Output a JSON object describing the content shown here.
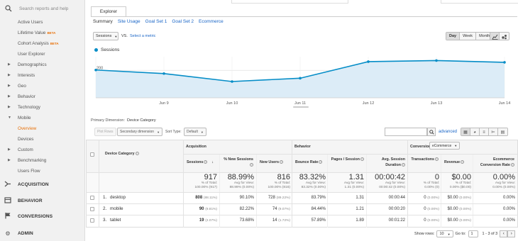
{
  "sidebar": {
    "search_placeholder": "Search reports and help",
    "items": [
      {
        "label": "Active Users",
        "beta": ""
      },
      {
        "label": "Lifetime Value",
        "beta": "BETA"
      },
      {
        "label": "Cohort Analysis",
        "beta": "BETA"
      },
      {
        "label": "User Explorer",
        "beta": ""
      },
      {
        "label": "Demographics",
        "beta": ""
      },
      {
        "label": "Interests",
        "beta": ""
      },
      {
        "label": "Geo",
        "beta": ""
      },
      {
        "label": "Behavior",
        "beta": ""
      },
      {
        "label": "Technology",
        "beta": ""
      },
      {
        "label": "Mobile",
        "beta": ""
      },
      {
        "label": "Overview",
        "beta": ""
      },
      {
        "label": "Devices",
        "beta": ""
      },
      {
        "label": "Custom",
        "beta": ""
      },
      {
        "label": "Benchmarking",
        "beta": ""
      },
      {
        "label": "Users Flow",
        "beta": ""
      }
    ],
    "sections": [
      {
        "label": "ACQUISITION",
        "icon": "acquisition-icon"
      },
      {
        "label": "BEHAVIOR",
        "icon": "behavior-icon"
      },
      {
        "label": "CONVERSIONS",
        "icon": "flag-icon"
      },
      {
        "label": "ADMIN",
        "icon": "gear-icon"
      }
    ]
  },
  "explorer": {
    "tab_label": "Explorer",
    "subtabs": [
      "Summary",
      "Site Usage",
      "Goal Set 1",
      "Goal Set 2",
      "Ecommerce"
    ],
    "metric": "Sessions",
    "vs": "VS.",
    "select_metric": "Select a metric",
    "period": [
      "Day",
      "Week",
      "Month"
    ]
  },
  "chart_data": {
    "type": "area",
    "series": [
      {
        "name": "Sessions",
        "values": [
          203,
          177,
          119,
          143,
          264,
          272,
          259
        ]
      }
    ],
    "x": [
      "Jun 8",
      "Jun 9",
      "Jun 10",
      "Jun 11",
      "Jun 12",
      "Jun 13",
      "Jun 14"
    ],
    "x_tick_labels": [
      "Jun 9",
      "Jun 10",
      "Jun 11",
      "Jun 12",
      "Jun 13",
      "Jun 14"
    ],
    "y_tick_labels": [
      "200",
      "100"
    ],
    "y_ticks": [
      200,
      100
    ],
    "ylim": [
      0,
      300
    ],
    "color": "#058dc7",
    "fill": "#dcecf7",
    "grid": true,
    "legend": "top-left"
  },
  "table": {
    "primary_dimension_label": "Primary Dimension:",
    "primary_dimension_value": "Device Category",
    "plot_rows": "Plot Rows",
    "secondary_dimension": "Secondary dimension",
    "sort_type_label": "Sort Type:",
    "sort_type_value": "Default",
    "advanced": "advanced",
    "groups": {
      "acquisition": "Acquisition",
      "behavior": "Behavior",
      "conversions": "Conversions",
      "conversion_select": "eCommerce"
    },
    "headers": {
      "device_category": "Device Category",
      "sessions": "Sessions",
      "new_sessions": "% New Sessions",
      "new_users": "New Users",
      "bounce_rate": "Bounce Rate",
      "pages_session": "Pages / Session",
      "avg_duration": "Avg. Session Duration",
      "transactions": "Transactions",
      "revenue": "Revenue",
      "ecom_rate": "Ecommerce Conversion Rate"
    },
    "totals": {
      "sessions": {
        "value": "917",
        "sub1": "% of Total:",
        "sub2": "100.00% (917)"
      },
      "new_sessions": {
        "value": "88.99%",
        "sub1": "Avg for View:",
        "sub2": "88.99% (0.00%)"
      },
      "new_users": {
        "value": "816",
        "sub1": "% of Total:",
        "sub2": "100.00% (816)"
      },
      "bounce_rate": {
        "value": "83.32%",
        "sub1": "Avg for View:",
        "sub2": "83.32% (0.00%)"
      },
      "pages_session": {
        "value": "1.31",
        "sub1": "Avg for View:",
        "sub2": "1.31 (0.00%)"
      },
      "avg_duration": {
        "value": "00:00:42",
        "sub1": "Avg for View:",
        "sub2": "00:00:42 (0.00%)"
      },
      "transactions": {
        "value": "0",
        "sub1": "% of Total:",
        "sub2": "0.00% (0)"
      },
      "revenue": {
        "value": "$0.00",
        "sub1": "% of Total:",
        "sub2": "0.00% ($0.00)"
      },
      "ecom_rate": {
        "value": "0.00%",
        "sub1": "Avg for View:",
        "sub2": "0.00% (0.00%)"
      }
    },
    "rows": [
      {
        "num": "1.",
        "name": "desktop",
        "sessions": "808",
        "sessions_pct": "(88.11%)",
        "new_sessions": "90.10%",
        "new_users": "728",
        "new_users_pct": "(89.22%)",
        "bounce_rate": "83.79%",
        "pages_session": "1.31",
        "avg_duration": "00:00:44",
        "transactions": "0",
        "transactions_pct": "(0.00%)",
        "revenue": "$0.00",
        "revenue_pct": "(0.00%)",
        "ecom_rate": "0.00%"
      },
      {
        "num": "2.",
        "name": "mobile",
        "sessions": "90",
        "sessions_pct": "(9.81%)",
        "new_sessions": "82.22%",
        "new_users": "74",
        "new_users_pct": "(9.07%)",
        "bounce_rate": "84.44%",
        "pages_session": "1.21",
        "avg_duration": "00:00:20",
        "transactions": "0",
        "transactions_pct": "(0.00%)",
        "revenue": "$0.00",
        "revenue_pct": "(0.00%)",
        "ecom_rate": "0.00%"
      },
      {
        "num": "3.",
        "name": "tablet",
        "sessions": "19",
        "sessions_pct": "(2.07%)",
        "new_sessions": "73.68%",
        "new_users": "14",
        "new_users_pct": "(1.72%)",
        "bounce_rate": "57.89%",
        "pages_session": "1.89",
        "avg_duration": "00:01:22",
        "transactions": "0",
        "transactions_pct": "(0.00%)",
        "revenue": "$0.00",
        "revenue_pct": "(0.00%)",
        "ecom_rate": "0.00%"
      }
    ]
  },
  "pager": {
    "show_rows_label": "Show rows:",
    "show_rows_value": "10",
    "goto_label": "Go to:",
    "goto_value": "1",
    "range": "1 - 3 of 3"
  }
}
